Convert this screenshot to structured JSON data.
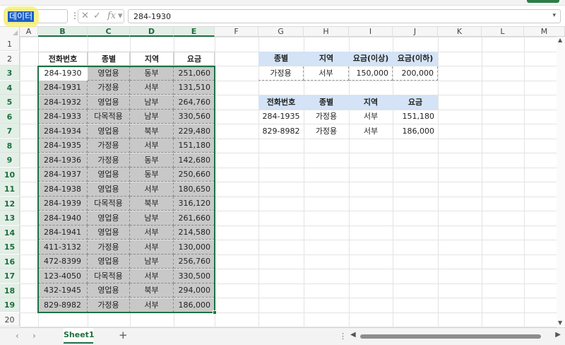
{
  "name_box": "데이터",
  "formula_value": "284-1930",
  "columns": [
    "A",
    "B",
    "C",
    "D",
    "E",
    "F",
    "G",
    "H",
    "I",
    "J",
    "K",
    "L",
    "M"
  ],
  "rows": [
    "1",
    "2",
    "3",
    "4",
    "5",
    "6",
    "7",
    "8",
    "9",
    "10",
    "11",
    "12",
    "13",
    "14",
    "15",
    "16",
    "17",
    "18",
    "19",
    "20"
  ],
  "main_table": {
    "headers": [
      "전화번호",
      "종별",
      "지역",
      "요금"
    ],
    "rows": [
      [
        "284-1930",
        "영업용",
        "동부",
        "251,060"
      ],
      [
        "284-1931",
        "가정용",
        "서부",
        "131,510"
      ],
      [
        "284-1932",
        "영업용",
        "남부",
        "264,760"
      ],
      [
        "284-1933",
        "다목적용",
        "남부",
        "330,560"
      ],
      [
        "284-1934",
        "영업용",
        "북부",
        "229,480"
      ],
      [
        "284-1935",
        "가정용",
        "서부",
        "151,180"
      ],
      [
        "284-1936",
        "가정용",
        "동부",
        "142,680"
      ],
      [
        "284-1937",
        "영업용",
        "동부",
        "250,660"
      ],
      [
        "284-1938",
        "영업용",
        "서부",
        "180,650"
      ],
      [
        "284-1939",
        "다목적용",
        "북부",
        "316,120"
      ],
      [
        "284-1940",
        "영업용",
        "남부",
        "261,660"
      ],
      [
        "284-1941",
        "영업용",
        "서부",
        "214,580"
      ],
      [
        "411-3132",
        "가정용",
        "서부",
        "130,000"
      ],
      [
        "472-8399",
        "영업용",
        "남부",
        "256,760"
      ],
      [
        "123-4050",
        "다목적용",
        "서부",
        "330,500"
      ],
      [
        "432-1945",
        "영업용",
        "북부",
        "294,000"
      ],
      [
        "829-8982",
        "가정용",
        "서부",
        "186,000"
      ]
    ]
  },
  "criteria_table": {
    "headers": [
      "종별",
      "지역",
      "요금(이상)",
      "요금(이하)"
    ],
    "row": [
      "가정용",
      "서부",
      "150,000",
      "200,000"
    ]
  },
  "result_table": {
    "headers": [
      "전화번호",
      "종별",
      "지역",
      "요금"
    ],
    "rows": [
      [
        "284-1935",
        "가정용",
        "서부",
        "151,180"
      ],
      [
        "829-8982",
        "가정용",
        "서부",
        "186,000"
      ]
    ]
  },
  "sheet_tab": "Sheet1",
  "colors": {
    "accent": "#1e7145",
    "header_fill": "#d4e3f5",
    "selection_fill": "#c8c8c8",
    "name_highlight": "#f5ee6a"
  }
}
